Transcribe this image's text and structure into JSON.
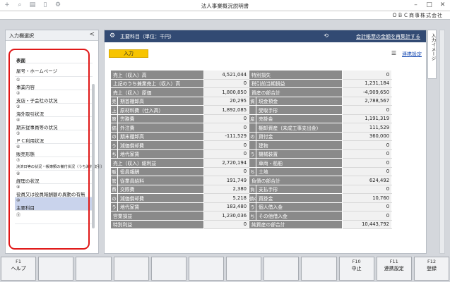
{
  "window": {
    "title": "法人事業概況説明書",
    "company": "ＯＢＣ商事株式会社"
  },
  "left_panel": {
    "header": "入力欄選択",
    "collapse": "<",
    "items": [
      {
        "num": "",
        "label": "表面",
        "style": "bold"
      },
      {
        "num": "",
        "label": "屋号・ホームページ",
        "style": "plain"
      },
      {
        "num": "①",
        "label": "事業内容",
        "style": ""
      },
      {
        "num": "②",
        "label": "支店・子会社の状況",
        "style": ""
      },
      {
        "num": "③",
        "label": "海外取引状況",
        "style": ""
      },
      {
        "num": "④",
        "label": "期末従事員等の状況",
        "style": ""
      },
      {
        "num": "⑤",
        "label": "ＰＣ利用状況",
        "style": ""
      },
      {
        "num": "⑥",
        "label": "販売形態",
        "style": ""
      },
      {
        "num": "⑦",
        "label": "決済日等の状況・帳簿類の備付状況（うち海外取引）",
        "style": "small"
      },
      {
        "num": "⑧",
        "label": "経理の状況",
        "style": ""
      },
      {
        "num": "⑨",
        "label": "役員又は役員報酬額の異動の有無",
        "style": ""
      },
      {
        "num": "⑩",
        "label": "主要科目",
        "style": "selected"
      },
      {
        "num": "⑪",
        "label": "",
        "style": ""
      }
    ]
  },
  "main": {
    "title": "主要科目（単位：千円）",
    "header_link": "会計帳票の金額を再集計する",
    "input_tab": "入力",
    "link_settings": "連携設定",
    "left_rows": [
      {
        "side": "",
        "label": "売上（収入）高",
        "value": "4,521,044",
        "type": "lab"
      },
      {
        "side": "",
        "label": "上記のうち兼業売上（収入）高",
        "value": "0",
        "type": "lab"
      },
      {
        "side": "",
        "label": "売上（収入）原価",
        "value": "1,800,850",
        "type": "lab"
      },
      {
        "side": "売",
        "label": "期首棚卸高",
        "value": "20,295",
        "type": "sub"
      },
      {
        "side": "上",
        "label": "原材料費（仕入高）",
        "value": "1,892,085",
        "type": "sub"
      },
      {
        "side": "原",
        "label": "労務費",
        "value": "0",
        "type": "sub"
      },
      {
        "side": "価",
        "label": "外注費",
        "value": "0",
        "type": "sub"
      },
      {
        "side": "の",
        "label": "期末棚卸高",
        "value": "-111,529",
        "type": "sub"
      },
      {
        "side": "う",
        "label": "減価償却費",
        "value": "0",
        "type": "sub"
      },
      {
        "side": "ち",
        "label": "地代家賃",
        "value": "0",
        "type": "sub"
      },
      {
        "side": "",
        "label": "売上（収入）総利益",
        "value": "2,720,194",
        "type": "lab"
      },
      {
        "side": "販",
        "label": "役員報酬",
        "value": "0",
        "type": "sub"
      },
      {
        "side": "管",
        "label": "従業員給料",
        "value": "191,749",
        "type": "sub"
      },
      {
        "side": "費",
        "label": "交際費",
        "value": "2,380",
        "type": "sub"
      },
      {
        "side": "の",
        "label": "減価償却費",
        "value": "5,218",
        "type": "sub"
      },
      {
        "side": "う",
        "label": "地代家賃",
        "value": "183,480",
        "type": "sub"
      },
      {
        "side": "",
        "label": "営業損益",
        "value": "1,230,036",
        "type": "lab"
      },
      {
        "side": "",
        "label": "特別利益",
        "value": "0",
        "type": "lab"
      }
    ],
    "right_rows": [
      {
        "side": "",
        "label": "特別損失",
        "value": "0",
        "type": "lab"
      },
      {
        "side": "",
        "label": "税引前当期損益",
        "value": "1,231,184",
        "type": "lab"
      },
      {
        "side": "",
        "label": "資産の部合計",
        "value": "-4,909,650",
        "type": "lab"
      },
      {
        "side": "資",
        "label": "現金預金",
        "value": "2,788,567",
        "type": "sub"
      },
      {
        "side": "",
        "label": "受取手形",
        "value": "0",
        "type": "sub"
      },
      {
        "side": "産",
        "label": "売掛金",
        "value": "1,191,319",
        "type": "sub"
      },
      {
        "side": "",
        "label": "棚卸資産（未成工事支出金）",
        "value": "111,529",
        "type": "sub"
      },
      {
        "side": "の",
        "label": "貸付金",
        "value": "360,000",
        "type": "sub"
      },
      {
        "side": "",
        "label": "建物",
        "value": "0",
        "type": "sub"
      },
      {
        "side": "う",
        "label": "機械装置",
        "value": "0",
        "type": "sub"
      },
      {
        "side": "",
        "label": "車両・船舶",
        "value": "0",
        "type": "sub"
      },
      {
        "side": "ち",
        "label": "土地",
        "value": "0",
        "type": "sub"
      },
      {
        "side": "",
        "label": "負債の部合計",
        "value": "624,492",
        "type": "lab"
      },
      {
        "side": "負",
        "label": "支払手形",
        "value": "0",
        "type": "sub"
      },
      {
        "side": "債の",
        "label": "買掛金",
        "value": "10,760",
        "type": "sub"
      },
      {
        "side": "う",
        "label": "個人借入金",
        "value": "0",
        "type": "sub"
      },
      {
        "side": "ち",
        "label": "その他借入金",
        "value": "0",
        "type": "sub"
      },
      {
        "side": "",
        "label": "純資産の部合計",
        "value": "10,443,792",
        "type": "lab"
      }
    ]
  },
  "side_tab": "入力イメージ",
  "function_keys": [
    {
      "num": "F1",
      "label": "ヘルプ"
    },
    {
      "num": "",
      "label": ""
    },
    {
      "num": "",
      "label": ""
    },
    {
      "num": "",
      "label": ""
    },
    {
      "num": "",
      "label": ""
    },
    {
      "num": "",
      "label": ""
    },
    {
      "num": "",
      "label": ""
    },
    {
      "num": "",
      "label": ""
    },
    {
      "num": "",
      "label": ""
    },
    {
      "num": "F10",
      "label": "中止"
    },
    {
      "num": "F11",
      "label": "連携設定"
    },
    {
      "num": "F12",
      "label": "登録"
    }
  ],
  "colors": {
    "header_bg": "#324a73",
    "input_tab": "#f7c400",
    "highlight_frame": "#e01818",
    "label_gray": "#8a8a8a"
  }
}
